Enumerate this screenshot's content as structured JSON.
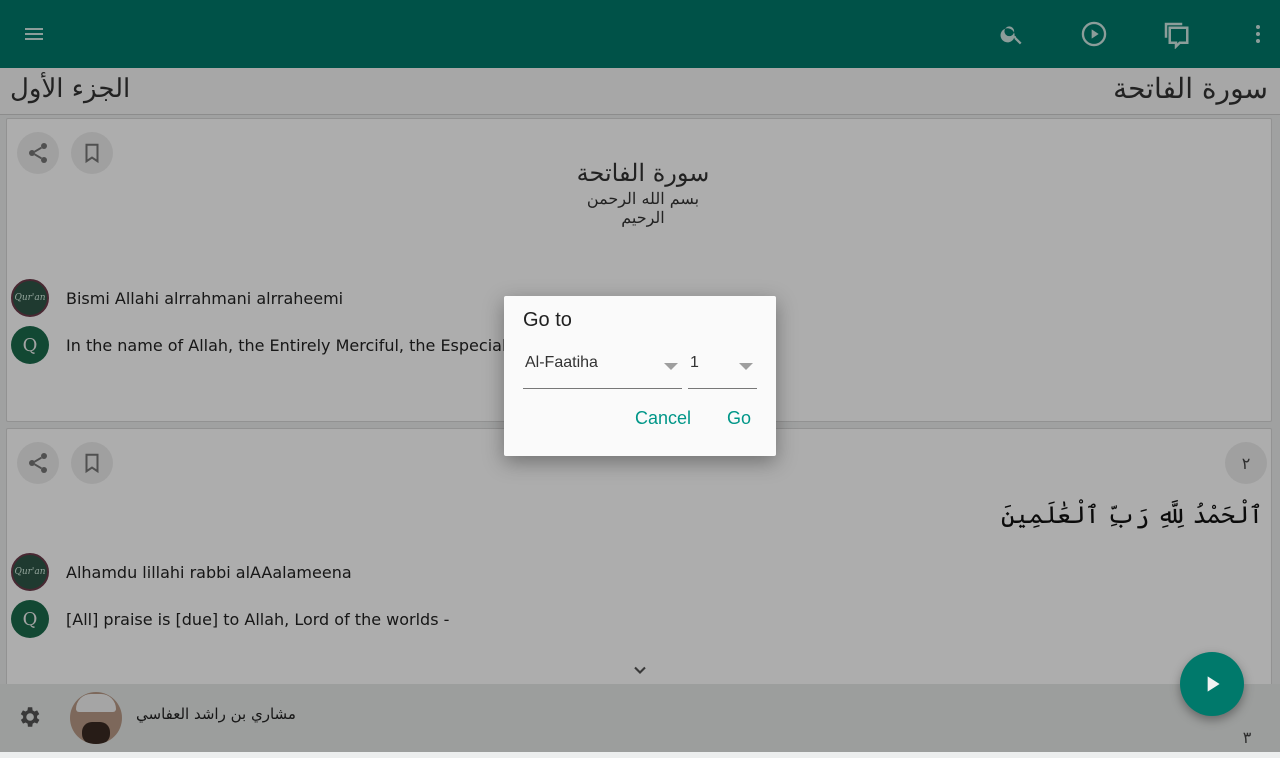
{
  "toolbar": {
    "menu_icon": "menu-icon",
    "search_icon": "search-icon",
    "play_icon": "play-circle-icon",
    "tafsir_icon": "chat-pages-icon",
    "more_icon": "more-vert-icon"
  },
  "header": {
    "juz_title": "الجزء الأول",
    "surah_title": "سورة الفاتحة"
  },
  "ayah1": {
    "surah_name": "سورة الفاتحة",
    "basmala": "بسم الله الرحمن الرحيم",
    "transliteration": "Bismi Allahi alrrahmani alrraheemi",
    "translation": "In the name of Allah, the Entirely Merciful, the Especially Merciful.",
    "badge_a": "Qur'an",
    "badge_b": "Q"
  },
  "ayah2": {
    "number": "٢",
    "arabic": "ٱلْحَمْدُ لِلَّهِ رَبِّ ٱلْعَٰلَمِينَ",
    "transliteration": "Alhamdu lillahi rabbi alAAalameena",
    "translation": "[All] praise is [due] to Allah, Lord of the worlds -",
    "badge_a": "Qur'an",
    "badge_b": "Q"
  },
  "next_ayah_number": "٣",
  "dialog": {
    "title": "Go to",
    "surah_selected": "Al-Faatiha",
    "ayah_selected": "1",
    "cancel_label": "Cancel",
    "go_label": "Go"
  },
  "player": {
    "reciter_name": "مشاري بن راشد العفاسي",
    "settings_icon": "gear-icon",
    "play_icon": "play-icon"
  },
  "colors": {
    "primary": "#00796b",
    "accent": "#009688"
  }
}
